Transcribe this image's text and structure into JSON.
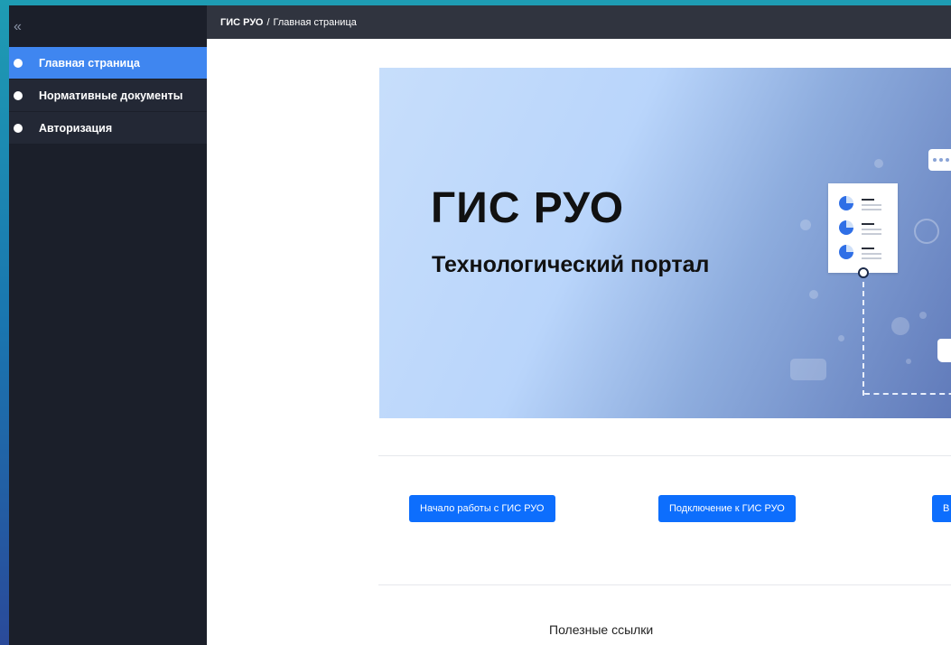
{
  "sidebar": {
    "collapse_icon": "«",
    "items": [
      {
        "label": "Главная страница",
        "active": true
      },
      {
        "label": "Нормативные документы",
        "active": false
      },
      {
        "label": "Авторизация",
        "active": false
      }
    ]
  },
  "breadcrumb": {
    "root": "ГИС РУО",
    "separator": "/",
    "current": "Главная страница"
  },
  "banner": {
    "title": "ГИС РУО",
    "subtitle": "Технологический портал"
  },
  "actions": {
    "start_label": "Начало работы с ГИС РУО",
    "connect_label": "Подключение к ГИС РУО",
    "third_label": "В"
  },
  "links_section": {
    "title": "Полезные ссылки"
  },
  "colors": {
    "accent": "#3f86f0",
    "button": "#0d6efd",
    "sidebar_bg": "#1b1f2a",
    "topbar_bg": "#30343f"
  }
}
